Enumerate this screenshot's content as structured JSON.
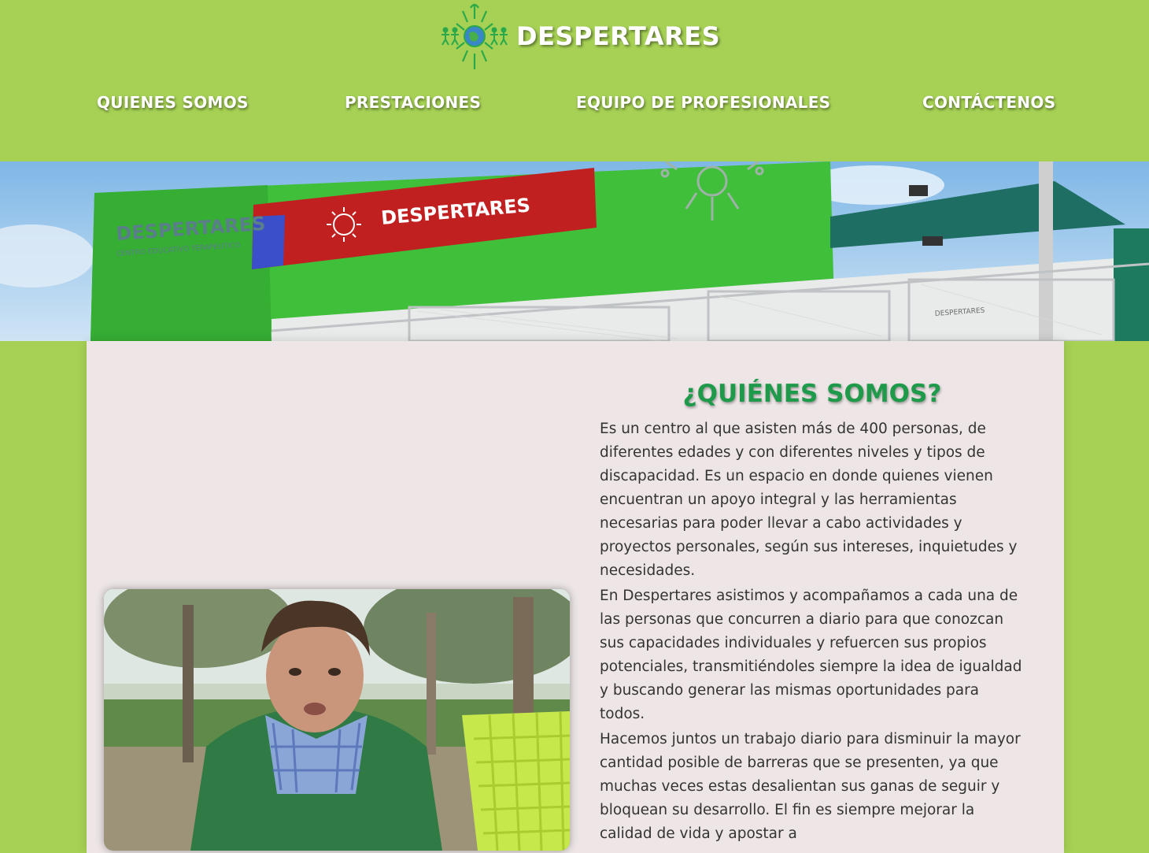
{
  "header": {
    "brand": "DESPERTARES",
    "logo_icon": "sun-globe-people-logo-icon"
  },
  "nav": {
    "items": [
      {
        "label": "QUIENES SOMOS"
      },
      {
        "label": "PRESTACIONES"
      },
      {
        "label": "EQUIPO DE PROFESIONALES"
      },
      {
        "label": "CONTÁCTENOS"
      }
    ]
  },
  "banner": {
    "wall_sign": "DESPERTARES",
    "wall_subtitle": "CENTRO EDUCATIVO TERAPEUTICO",
    "red_sign": "DESPERTARES",
    "small_sign": "DESPERTARES"
  },
  "about": {
    "title": "¿QUIÉNES SOMOS?",
    "paragraphs": [
      "Es un centro al que asisten más de 400 personas, de diferentes edades y con diferentes niveles y tipos de discapacidad. Es un espacio en donde quienes vienen encuentran un apoyo integral y las herramientas necesarias para poder llevar a cabo actividades y proyectos personales, según sus intereses, inquietudes y necesidades.",
      "En Despertares asistimos y acompañamos a cada una de las personas que concurren a diario para que conozcan sus capacidades individuales y refuercen sus propios potenciales, transmitiéndoles siempre la idea de igualdad y buscando generar las mismas oportunidades para todos.",
      "Hacemos juntos un trabajo diario para disminuir la mayor cantidad posible de barreras que se presenten, ya que muchas veces estas desalientan sus ganas de seguir y bloquean su desarrollo. El fin es siempre mejorar la calidad de vida y apostar a"
    ]
  },
  "colors": {
    "background": "#a6d154",
    "panel": "#eee6e6",
    "title_green": "#1f9a4a",
    "sign_red": "#c0201f",
    "wall_green": "#3fbf3a"
  }
}
